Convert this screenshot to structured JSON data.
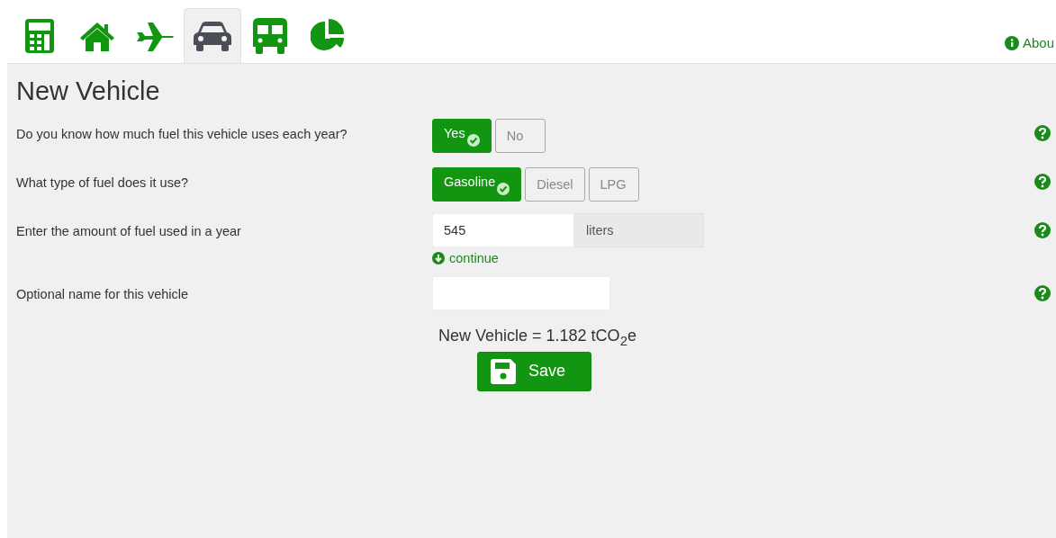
{
  "tabs": [
    {
      "kind": "calculator",
      "selected": false
    },
    {
      "kind": "house",
      "selected": false
    },
    {
      "kind": "plane",
      "selected": false
    },
    {
      "kind": "car",
      "selected": true
    },
    {
      "kind": "bus",
      "selected": false
    },
    {
      "kind": "pie",
      "selected": false
    }
  ],
  "about_link": "Abou",
  "title": "New Vehicle",
  "questions": [
    {
      "kind": "choice",
      "label": "Do you know how much fuel this vehicle uses each year?",
      "options": [
        {
          "label": "Yes",
          "selected": true
        },
        {
          "label": "No",
          "selected": false
        }
      ]
    },
    {
      "kind": "choice",
      "label": "What type of fuel does it use?",
      "options": [
        {
          "label": "Gasoline",
          "selected": true
        },
        {
          "label": "Diesel",
          "selected": false
        },
        {
          "label": "LPG",
          "selected": false
        }
      ]
    },
    {
      "kind": "amount",
      "label": "Enter the amount of fuel used in a year",
      "value": "545",
      "unit": "liters",
      "link": "continue"
    },
    {
      "kind": "text",
      "label": "Optional name for this vehicle"
    }
  ],
  "result": "New Vehicle = 1.182 tCO$_{2}$e",
  "save_button": "Save"
}
